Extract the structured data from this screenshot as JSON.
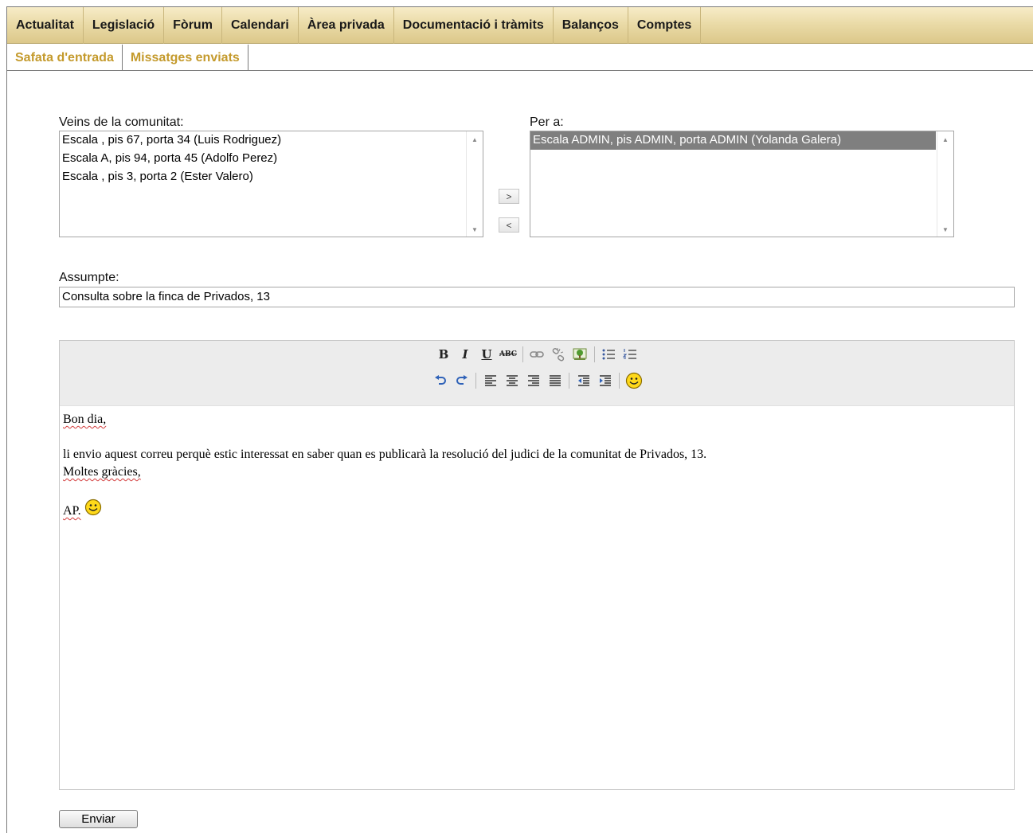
{
  "nav": {
    "items": [
      "Actualitat",
      "Legislació",
      "Fòrum",
      "Calendari",
      "Àrea privada",
      "Documentació i tràmits",
      "Balanços",
      "Comptes"
    ]
  },
  "subnav": {
    "items": [
      "Safata d'entrada",
      "Missatges enviats"
    ]
  },
  "compose": {
    "neighbors_label": "Veins de la comunitat:",
    "neighbors": [
      "Escala , pis 67, porta 34 (Luis Rodriguez)",
      "Escala A, pis 94, porta 45 (Adolfo Perez)",
      "Escala , pis 3, porta 2 (Ester Valero)"
    ],
    "add_label": ">",
    "remove_label": "<",
    "recipients_label": "Per a:",
    "recipients": [
      "Escala ADMIN, pis ADMIN, porta ADMIN (Yolanda Galera)"
    ],
    "subject_label": "Assumpte:",
    "subject_value": "Consulta sobre la finca de Privados, 13",
    "send_label": "Enviar"
  },
  "editor": {
    "toolbar_row1": [
      "bold",
      "italic",
      "underline",
      "strikethrough",
      "link",
      "unlink",
      "image",
      "bullet-list",
      "numbered-list"
    ],
    "toolbar_row2": [
      "undo",
      "redo",
      "align-left",
      "align-center",
      "align-right",
      "align-justify",
      "outdent",
      "indent",
      "emoticon"
    ],
    "greeting": "Bon dia,",
    "body_line1": "li envio aquest correu perquè estic interessat en saber quan es publicarà la resolució del judici de la comunitat de Privados, 13.",
    "body_line2": "Moltes gràcies,",
    "signature": "AP."
  }
}
